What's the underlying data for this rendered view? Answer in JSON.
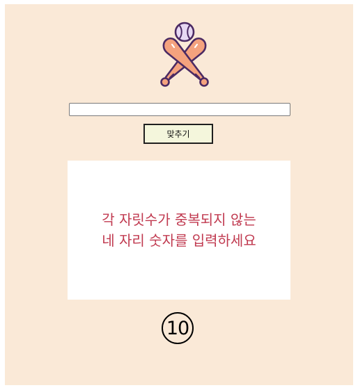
{
  "game": {
    "logo_icon": "baseball-bats-icon",
    "guess_input": {
      "value": "",
      "placeholder": ""
    },
    "submit_label": "맞추기",
    "message_line1": "각 자릿수가 중복되지 않는",
    "message_line2": "네 자리 숫자를 입력하세요",
    "remaining_attempts": "10"
  },
  "colors": {
    "page_background": "#fae9d7",
    "message_text": "#c0394f",
    "button_background": "#f4f6dc"
  }
}
